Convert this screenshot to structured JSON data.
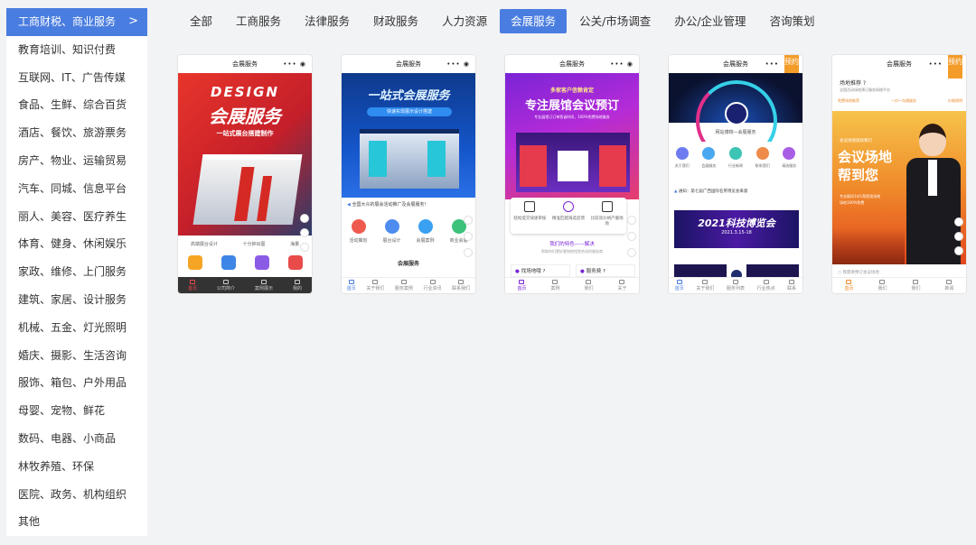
{
  "sidebar": {
    "items": [
      {
        "label": "工商财税、商业服务",
        "active": true
      },
      {
        "label": "教育培训、知识付费"
      },
      {
        "label": "互联网、IT、广告传媒"
      },
      {
        "label": "食品、生鲜、综合百货"
      },
      {
        "label": "酒店、餐饮、旅游票务"
      },
      {
        "label": "房产、物业、运输贸易"
      },
      {
        "label": "汽车、同城、信息平台"
      },
      {
        "label": "丽人、美容、医疗养生"
      },
      {
        "label": "体育、健身、休闲娱乐"
      },
      {
        "label": "家政、维修、上门服务"
      },
      {
        "label": "建筑、家居、设计服务"
      },
      {
        "label": "机械、五金、灯光照明"
      },
      {
        "label": "婚庆、摄影、生活咨询"
      },
      {
        "label": "服饰、箱包、户外用品"
      },
      {
        "label": "母婴、宠物、鲜花"
      },
      {
        "label": "数码、电器、小商品"
      },
      {
        "label": "林牧养殖、环保"
      },
      {
        "label": "医院、政务、机构组织"
      },
      {
        "label": "其他"
      }
    ],
    "chevron": ">"
  },
  "tabs": [
    {
      "label": "全部"
    },
    {
      "label": "工商服务"
    },
    {
      "label": "法律服务"
    },
    {
      "label": "财政服务"
    },
    {
      "label": "人力资源"
    },
    {
      "label": "会展服务",
      "active": true
    },
    {
      "label": "公关/市场调查"
    },
    {
      "label": "办公/企业管理"
    },
    {
      "label": "咨询策划"
    }
  ],
  "cards": [
    {
      "title": "会展服务",
      "dots": "••• ◉",
      "hero_line1": "DESIGN",
      "hero_line2": "会展服务",
      "hero_line3": "一站式展台搭建制作",
      "features": [
        "高端展台设计",
        "十分钟出图",
        "海量"
      ],
      "nav": [
        "首页",
        "公司简介",
        "案例展示",
        "我的"
      ]
    },
    {
      "title": "会展服务",
      "dots": "••• ◉",
      "hero_line1": "一站式会展服务",
      "hero_line2": "快速实现展示设计搭建",
      "notice": "全国大众的展会活动推广及会展服务！",
      "icons": [
        "活动策划",
        "展台设计",
        "会展案例",
        "商业会展"
      ],
      "section": "会展服务",
      "nav": [
        "首页",
        "关于我们",
        "服务案例",
        "行业资讯",
        "联系我们"
      ]
    },
    {
      "title": "会展服务",
      "dots": "••• ◉",
      "hero_line1": "多家客户信赖肯定",
      "hero_line2": "专注展馆会议预订",
      "hero_line3": "专业展馆订订单您省时间，100%免费场地服务",
      "features": [
        "轻松提交快速审核",
        "精准匹配海选反馈",
        "比较双价格产服场地"
      ],
      "section": "我们的特色——解决",
      "section_sub": "帮助你们更好更快地找到合适的服务商",
      "items": [
        "找场地哦 ?",
        "服务费 ?"
      ],
      "nav": [
        "首页",
        "案例",
        "我们",
        "关于"
      ]
    },
    {
      "title": "会展服务",
      "dots": "•••",
      "badge": "预约",
      "brand": "网站博物—会展服务",
      "icons": [
        "关于我们",
        "会展服务",
        "行业新闻",
        "联系我们",
        "请选服务"
      ],
      "notice": "通知：第七届广西国际名茶博览会来袭",
      "banner_title": "2021科技博览会",
      "banner_date": "2021.3.15-18",
      "nav": [
        "首页",
        "关于我们",
        "服务列表",
        "行业热点",
        "联系"
      ]
    },
    {
      "title": "会展服务",
      "dots": "•••",
      "badge": "预约",
      "line1": "场地推荐 ?",
      "line2": "全国活动场地预订服务网络平台",
      "chips": [
        "免费场地推荐",
        "一对一沟通服务",
        "价格透明"
      ],
      "hero_line1": "会议场地",
      "hero_line2": "帮到您",
      "hero_line3": "专业顾问1对1帮您找场地",
      "hero_line4": "场地100%免费",
      "hero_top": "会议场地就找我们",
      "input": "我需要预订会议场地",
      "nav": [
        "首页",
        "我们",
        "我们",
        "新闻"
      ]
    }
  ],
  "colors": {
    "accent": "#4a7de0",
    "badge": "#f39c29"
  }
}
